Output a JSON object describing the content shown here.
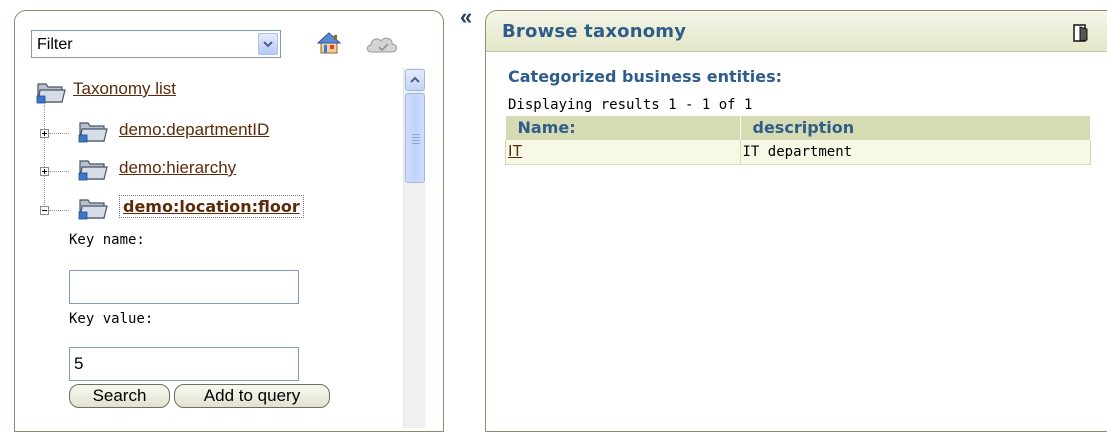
{
  "filter": {
    "selected": "Filter"
  },
  "tree": {
    "root_label": "Taxonomy list",
    "nodes": [
      {
        "label": "demo:departmentID",
        "expanded": false
      },
      {
        "label": "demo:hierarchy",
        "expanded": false
      },
      {
        "label": "demo:location:floor",
        "expanded": true
      }
    ],
    "form": {
      "key_name_label": "Key name:",
      "key_name_value": "",
      "key_value_label": "Key value:",
      "key_value_value": "5",
      "search_button": "Search",
      "add_query_button": "Add to query"
    }
  },
  "collapse_glyph": "«",
  "main": {
    "title": "Browse taxonomy",
    "subtitle": "Categorized business entities:",
    "results_text": "Displaying results 1 - 1 of 1",
    "table": {
      "headers": [
        "Name:",
        "description"
      ],
      "rows": [
        {
          "name": "IT",
          "description": "IT department"
        }
      ]
    }
  },
  "colors": {
    "accent_blue": "#2f5d8a",
    "link_brown": "#5c2a08",
    "header_olive": "#d7dbb4"
  },
  "icons": [
    "home-icon",
    "cloud-icon",
    "folder-icon",
    "exit-icon",
    "collapse-icon"
  ]
}
